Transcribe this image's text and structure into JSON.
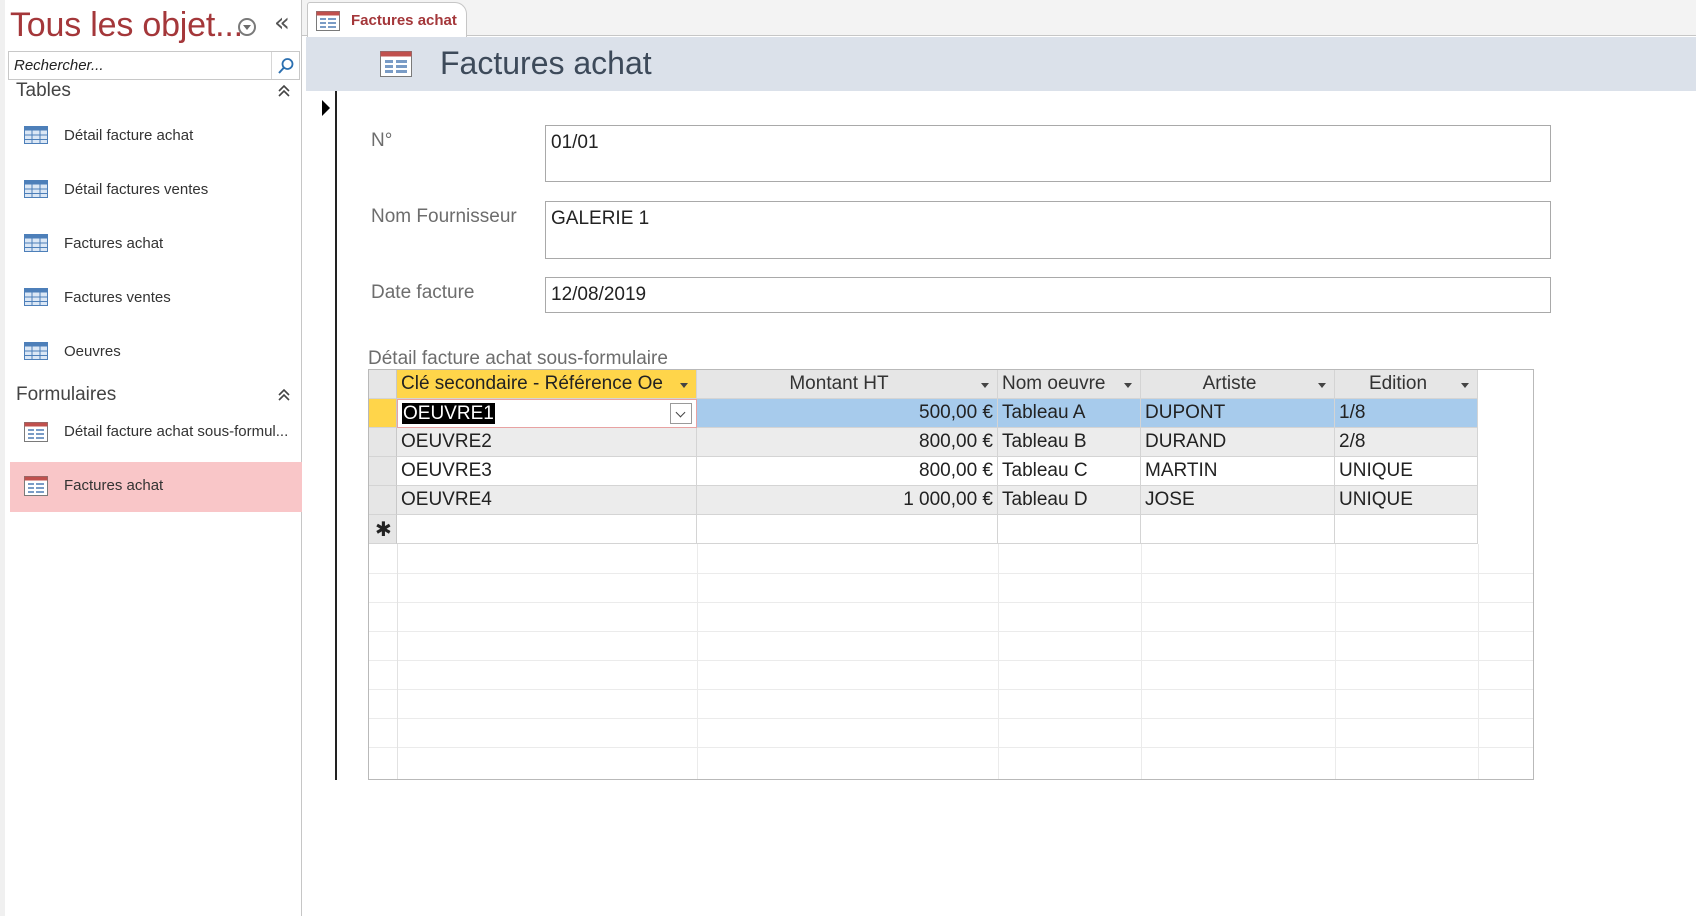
{
  "nav": {
    "title": "Tous les objet...",
    "search_placeholder": "Rechercher...",
    "groups": [
      {
        "title": "Tables",
        "items": [
          {
            "label": "Détail facture achat",
            "icon": "table-icon"
          },
          {
            "label": "Détail factures ventes",
            "icon": "table-icon"
          },
          {
            "label": "Factures achat",
            "icon": "table-icon"
          },
          {
            "label": "Factures ventes",
            "icon": "table-icon"
          },
          {
            "label": "Oeuvres",
            "icon": "table-icon"
          }
        ]
      },
      {
        "title": "Formulaires",
        "items": [
          {
            "label": "Détail facture achat sous-formul...",
            "icon": "form-icon"
          },
          {
            "label": "Factures achat",
            "icon": "form-icon",
            "selected": true
          }
        ]
      }
    ]
  },
  "tab": {
    "label": "Factures achat"
  },
  "form": {
    "title": "Factures achat",
    "fields": [
      {
        "label": "N°",
        "value": "01/01"
      },
      {
        "label": "Nom Fournisseur",
        "value": "GALERIE 1"
      },
      {
        "label": "Date facture",
        "value": "12/08/2019"
      }
    ],
    "subform": {
      "label": "Détail facture achat sous-formulaire",
      "columns": [
        "Clé secondaire - Référence Oe",
        "Montant HT",
        "Nom oeuvre",
        "Artiste",
        "Edition"
      ],
      "rows": [
        [
          "OEUVRE1",
          "500,00 €",
          "Tableau A",
          "DUPONT",
          "1/8"
        ],
        [
          "OEUVRE2",
          "800,00 €",
          "Tableau B",
          "DURAND",
          "2/8"
        ],
        [
          "OEUVRE3",
          "800,00 €",
          "Tableau C",
          "MARTIN",
          "UNIQUE"
        ],
        [
          "OEUVRE4",
          "1 000,00 €",
          "Tableau D",
          "JOSE",
          "UNIQUE"
        ]
      ]
    }
  },
  "colors": {
    "accent": "#a4373a",
    "selected_nav": "#f9c6c8",
    "sorted_header": "#ffd54a",
    "selected_row": "#a7cbec",
    "form_header": "#dbe1ea"
  }
}
